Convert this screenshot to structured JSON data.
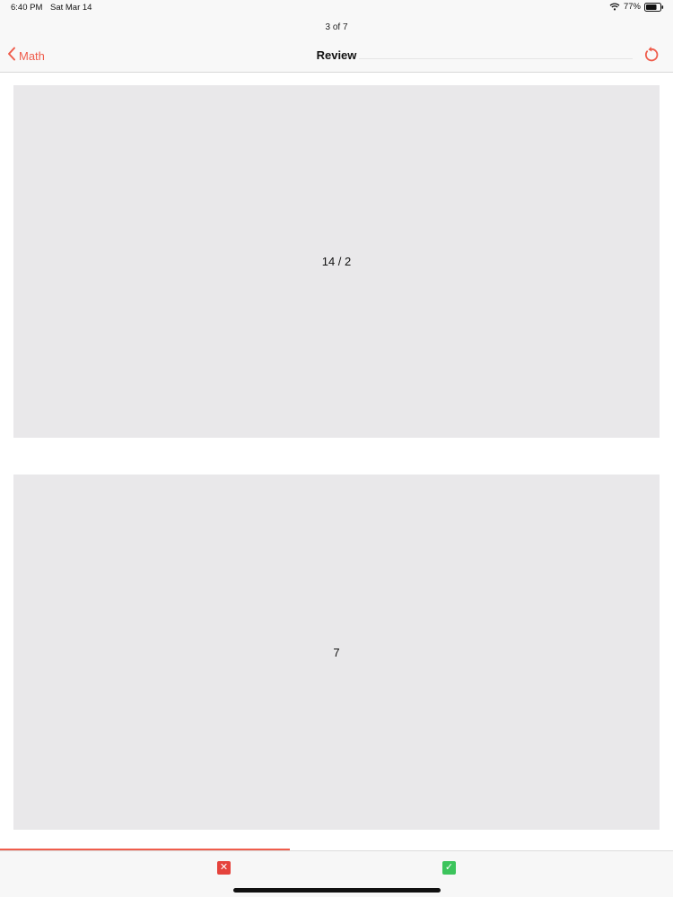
{
  "status_bar": {
    "time": "6:40 PM",
    "date": "Sat Mar 14",
    "battery": "77%",
    "battery_level": 0.77,
    "icons": [
      "wifi-icon",
      "battery-icon"
    ]
  },
  "header": {
    "counter": "3 of 7",
    "back_label": "Math",
    "title": "Review",
    "back_icon": "chevron-left-icon",
    "reset_icon": "rotate-ccw-icon"
  },
  "card": {
    "question": "14 / 2",
    "answer": "7"
  },
  "progress": {
    "current": 3,
    "total": 7,
    "fraction": 0.43
  },
  "toolbar": {
    "incorrect_icon": "close-icon",
    "incorrect_glyph": "✕",
    "correct_icon": "checkmark-icon",
    "correct_glyph": "✓"
  },
  "colors": {
    "accent": "#ef5d4c",
    "card_bg": "#e9e8ea",
    "incorrect": "#e5433c",
    "correct": "#3cc45c"
  }
}
